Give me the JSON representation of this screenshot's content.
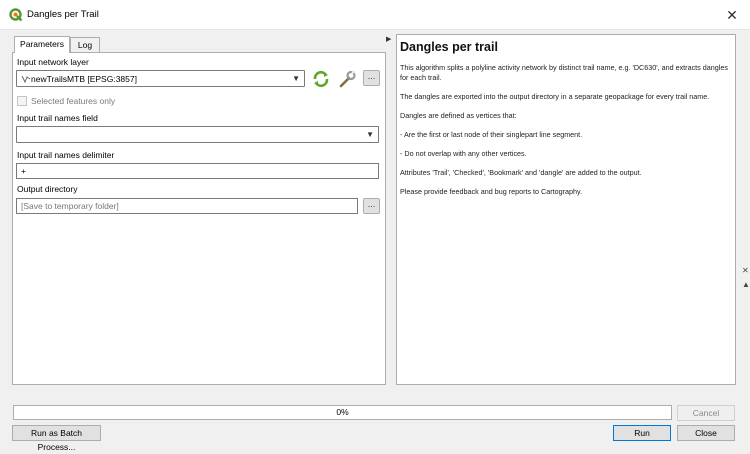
{
  "window": {
    "title": "Dangles per Trail",
    "close_glyph": "✕"
  },
  "tabs": [
    {
      "label": "Parameters"
    },
    {
      "label": "Log"
    }
  ],
  "params": {
    "input_network_layer_label": "Input network layer",
    "input_network_layer_value": "newTrailsMTB [EPSG:3857]",
    "selected_features_label": "Selected features only",
    "trail_names_field_label": "Input trail names field",
    "trail_names_field_value": "",
    "delimiter_label": "Input trail names delimiter",
    "delimiter_value": "+",
    "output_dir_label": "Output directory",
    "output_dir_placeholder": "[Save to temporary folder]",
    "ellipsis": "…"
  },
  "help": {
    "title": "Dangles per trail",
    "paragraphs": [
      "This algorithm splits a polyline activity network by distinct trail name, e.g. 'DC630', and extracts dangles for each trail.",
      "The dangles are exported into the output directory in a separate geopackage for every trail name.",
      "Dangles are defined as vertices that:",
      "- Are the first or last node of their singlepart line segment.",
      "- Do not overlap with any other vertices.",
      "Attributes 'Trail', 'Checked', 'Bookmark' and 'dangle' are added to the output.",
      "Please provide feedback and bug reports to Cartography."
    ]
  },
  "progress": {
    "percent": 0,
    "label": "0%"
  },
  "buttons": {
    "cancel": "Cancel",
    "batch": "Run as Batch Process...",
    "run": "Run",
    "close": "Close"
  },
  "icons": {
    "app": "qgis-icon",
    "iterate": "iterate-icon",
    "wrench": "wrench-icon",
    "line_layer": "line-layer-icon"
  },
  "colors": {
    "qgis_green": "#589632",
    "iterate_green": "#5aa92a"
  }
}
